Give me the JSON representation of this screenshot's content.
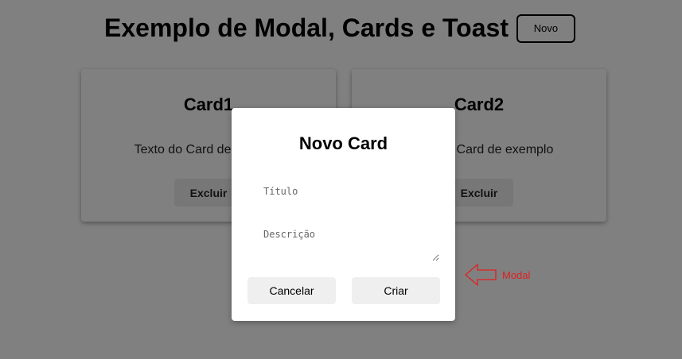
{
  "header": {
    "title": "Exemplo de Modal, Cards e Toast",
    "new_button": "Novo"
  },
  "cards": [
    {
      "title": "Card1",
      "text": "Texto do Card de exemplo",
      "delete_button": "Excluir"
    },
    {
      "title": "Card2",
      "text": "Texto do Card de exemplo",
      "delete_button": "Excluir"
    }
  ],
  "modal": {
    "title": "Novo Card",
    "title_placeholder": "Título",
    "description_placeholder": "Descrição",
    "cancel_button": "Cancelar",
    "create_button": "Criar"
  },
  "annotation": {
    "label": "Modal",
    "color": "#e0201f"
  },
  "colors": {
    "overlay": "#808080",
    "modal_bg": "#ffffff",
    "button_bg": "#efefef"
  }
}
